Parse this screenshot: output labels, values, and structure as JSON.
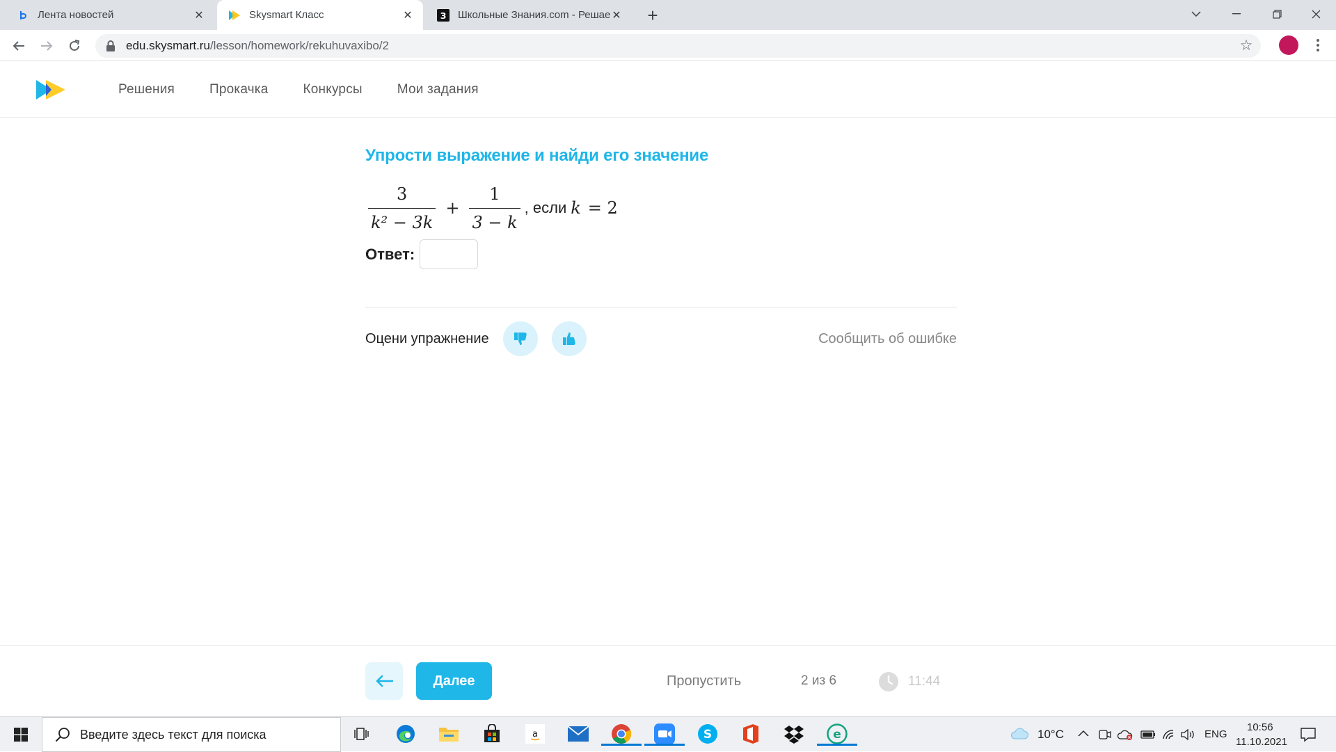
{
  "browser": {
    "tabs": [
      {
        "title": "Лента новостей",
        "active": false
      },
      {
        "title": "Skysmart Класс",
        "active": true
      },
      {
        "title": "Школьные Знания.com - Решае",
        "active": false
      }
    ],
    "url_host": "edu.skysmart.ru",
    "url_path": "/lesson/homework/rekuhuvaxibo/2"
  },
  "site": {
    "nav": [
      "Решения",
      "Прокачка",
      "Конкурсы",
      "Мои задания"
    ],
    "accent_color": "#1fb6e8"
  },
  "exercise": {
    "title": "Упрости выражение и найди его значение",
    "formula": {
      "frac1_num": "3",
      "frac1_den": "k² − 3k",
      "plus": "+",
      "frac2_num": "1",
      "frac2_den": "3 − k",
      "suffix": ", если",
      "condition_var": "k",
      "condition_eq": "= 2"
    },
    "answer_label": "Ответ:",
    "answer_value": "",
    "rate_label": "Оцени упражнение",
    "report_link": "Сообщить об ошибке"
  },
  "bottom": {
    "next_label": "Далее",
    "skip_label": "Пропустить",
    "progress": "2 из 6",
    "timer": "11:44"
  },
  "taskbar": {
    "search_placeholder": "Введите здесь текст для поиска",
    "temperature": "10°C",
    "language": "ENG",
    "time": "10:56",
    "date": "11.10.2021"
  }
}
